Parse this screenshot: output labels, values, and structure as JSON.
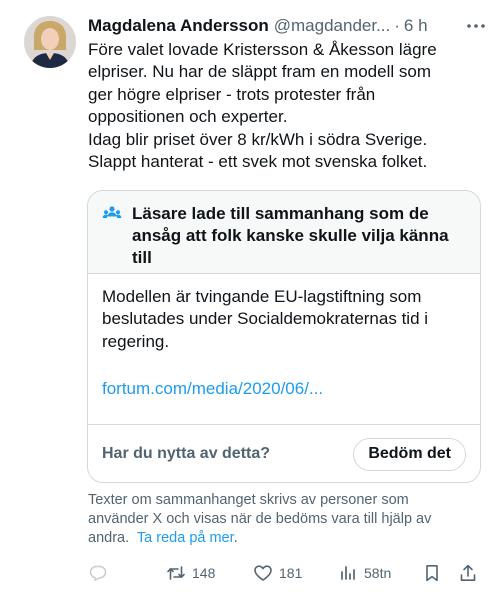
{
  "tweet": {
    "author_name": "Magdalena Andersson",
    "author_handle": "@magdander...",
    "separator": "·",
    "time": "6 h",
    "text_lines": [
      "Före valet lovade Kristersson & Åkesson lägre",
      "elpriser. Nu har de släppt fram en modell som",
      "ger högre elpriser - trots protester från",
      "oppositionen och experter.",
      "Idag blir priset över 8 kr/kWh i södra Sverige.",
      "Slappt hanterat - ett svek mot svenska folket."
    ]
  },
  "community_note": {
    "title_lines": [
      "Läsare lade till sammanhang som de",
      "ansåg att folk kanske skulle vilja känna",
      "till"
    ],
    "body_lines": [
      "Modellen är tvingande EU-lagstiftning som",
      "beslutades under Socialdemokraternas tid i",
      "regering."
    ],
    "link": "fortum.com/media/2020/06/...",
    "question": "Har du nytta av detta?",
    "rate_button": "Bedöm det"
  },
  "disclaimer": {
    "lines": [
      "Texter om sammanhanget skrivs av personer som",
      "använder X och visas när de bedöms vara till hjälp av"
    ],
    "last_line_prefix": "andra.",
    "learn_more": "Ta reda på mer",
    "learn_more_suffix": "."
  },
  "actions": {
    "reply_count": "",
    "repost_count": "148",
    "like_count": "181",
    "view_count": "58tn"
  },
  "icons": {
    "avatar": "avatar-photo",
    "more": "more-horizontal-icon",
    "note": "community-notes-people-icon",
    "reply": "reply-icon",
    "repost": "repost-icon",
    "like": "heart-icon",
    "views": "views-bar-chart-icon",
    "bookmark": "bookmark-icon",
    "share": "share-icon"
  },
  "colors": {
    "text": "#0f1419",
    "secondary": "#536471",
    "link": "#1d9bf0",
    "border": "#cfd9de",
    "note_header_bg": "#f7f9f9"
  }
}
